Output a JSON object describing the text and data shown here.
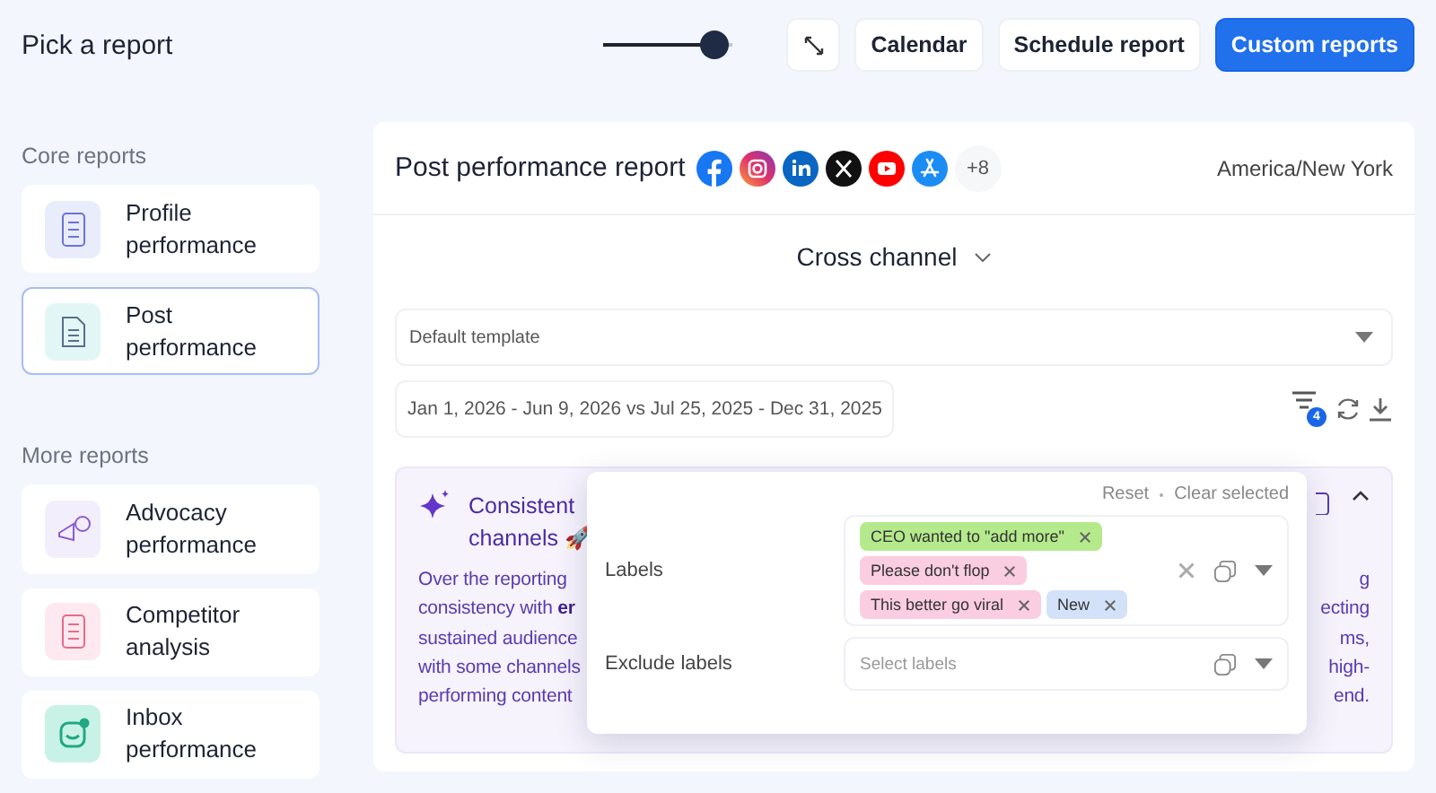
{
  "header": {
    "title": "Pick a report",
    "zoom_slider": {
      "level": 0.86
    },
    "buttons": [
      {
        "kind": "icon"
      },
      {
        "kind": "plain",
        "label": "Calendar"
      },
      {
        "kind": "plain",
        "label": "Schedule report"
      },
      {
        "kind": "primary",
        "label": "Custom reports"
      }
    ]
  },
  "sidebar": {
    "sections": [
      {
        "title": "Core reports",
        "items": [
          {
            "label": "Profile performance",
            "kind": "profile",
            "color": "#e9ecfb",
            "selected": false
          },
          {
            "label": "Post performance",
            "kind": "post",
            "color": "#e3f6f6",
            "selected": true
          }
        ]
      },
      {
        "title": "More reports",
        "items": [
          {
            "label": "Advocacy performance",
            "kind": "advocacy",
            "color": "#f3eefb",
            "selected": false
          },
          {
            "label": "Competitor analysis",
            "kind": "competitor",
            "color": "#fde9ef",
            "selected": false
          },
          {
            "label": "Inbox performance",
            "kind": "inbox",
            "color": "#c9f2e6",
            "selected": false
          }
        ]
      }
    ]
  },
  "report": {
    "title": "Post performance report",
    "networks": [
      {
        "kind": "facebook"
      },
      {
        "kind": "instagram"
      },
      {
        "kind": "linkedin"
      },
      {
        "kind": "x"
      },
      {
        "kind": "youtube"
      },
      {
        "kind": "appstore"
      }
    ],
    "more_networks": "+8",
    "timezone": "America/New York",
    "view": "Cross channel",
    "template": "Default template",
    "date_range": "Jan 1, 2026 - Jun 9, 2026 vs Jul 25, 2025 - Dec 31, 2025",
    "filter_count": "4",
    "insight": {
      "title_lines": [
        "Consistent",
        "channels 🚀"
      ],
      "body_lines": [
        {
          "left": "Over the reporting",
          "right": "g"
        },
        {
          "left": "consistency with **er**",
          "right": "ecting"
        },
        {
          "left": "sustained audience",
          "right": "ms,"
        },
        {
          "left": "with some channels",
          "right": "high-"
        },
        {
          "left": "performing content",
          "right": "end."
        }
      ]
    }
  },
  "filter_popover": {
    "links": [
      "Reset",
      "Clear selected"
    ],
    "fields": [
      {
        "label": "Labels",
        "tags": [
          {
            "text": "CEO wanted to \"add more\"",
            "color": "#b5ea8c"
          },
          {
            "text": "Please don't flop",
            "color": "#fbcde0"
          },
          {
            "text": "This better go viral",
            "color": "#fbcde0"
          },
          {
            "text": "New",
            "color": "#d3e2f8"
          }
        ]
      },
      {
        "label": "Exclude labels",
        "placeholder": "Select labels"
      }
    ]
  }
}
